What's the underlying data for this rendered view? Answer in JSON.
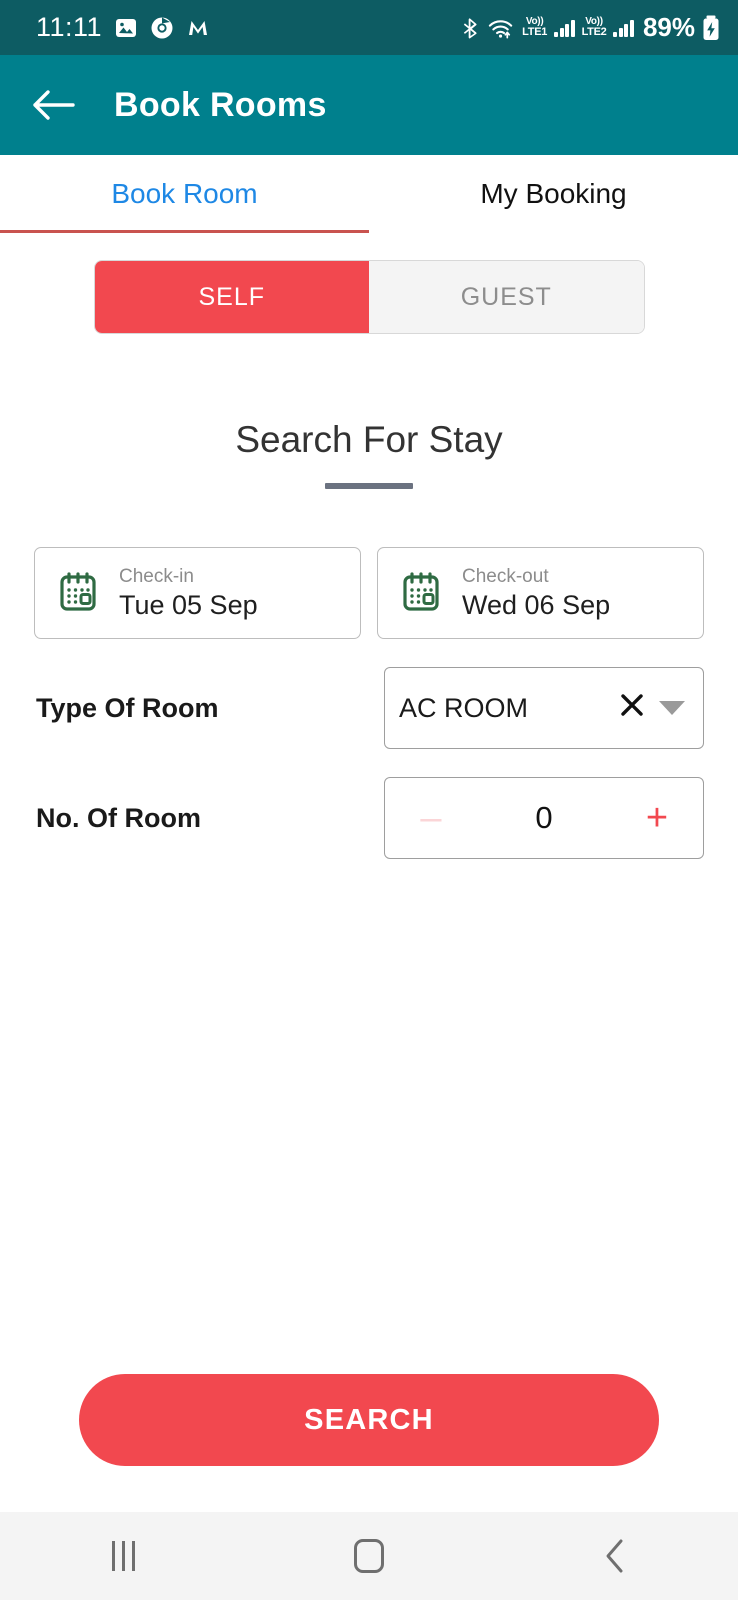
{
  "statusbar": {
    "time": "11:11",
    "notif_icons": [
      "image-icon",
      "chrome-icon",
      "m-app-icon"
    ],
    "bluetooth_icon": "bluetooth-icon",
    "wifi_icon": "wifi-icon",
    "sim1_label_top": "Vo))",
    "sim1_label_bottom": "LTE1",
    "sim2_label_top": "Vo))",
    "sim2_label_bottom": "LTE2",
    "battery_percent": "89%",
    "battery_icon": "battery-charging-icon"
  },
  "appbar": {
    "back_icon": "back-arrow-icon",
    "title": "Book Rooms",
    "background": "#00808d"
  },
  "tabs": [
    {
      "label": "Book Room",
      "active": true
    },
    {
      "label": "My Booking",
      "active": false
    }
  ],
  "segmented": {
    "options": [
      {
        "label": "SELF",
        "selected": true
      },
      {
        "label": "GUEST",
        "selected": false
      }
    ],
    "selected_color": "#f2484f",
    "unselected_color": "#f4f4f4"
  },
  "section": {
    "heading": "Search For Stay"
  },
  "dates": {
    "checkin": {
      "label": "Check-in",
      "value": "Tue 05 Sep",
      "icon": "calendar-icon"
    },
    "checkout": {
      "label": "Check-out",
      "value": "Wed 06 Sep",
      "icon": "calendar-icon"
    }
  },
  "room_type": {
    "label": "Type Of Room",
    "value": "AC ROOM",
    "clear_icon": "close-icon",
    "dropdown_icon": "chevron-down-icon"
  },
  "room_count": {
    "label": "No. Of Room",
    "value": "0",
    "minus_label": "–",
    "plus_label": "+",
    "minus_disabled": true
  },
  "actions": {
    "search_label": "SEARCH",
    "search_color": "#f2484f"
  },
  "navbar": {
    "recents": "recents-icon",
    "home": "home-icon",
    "back": "back-icon"
  }
}
